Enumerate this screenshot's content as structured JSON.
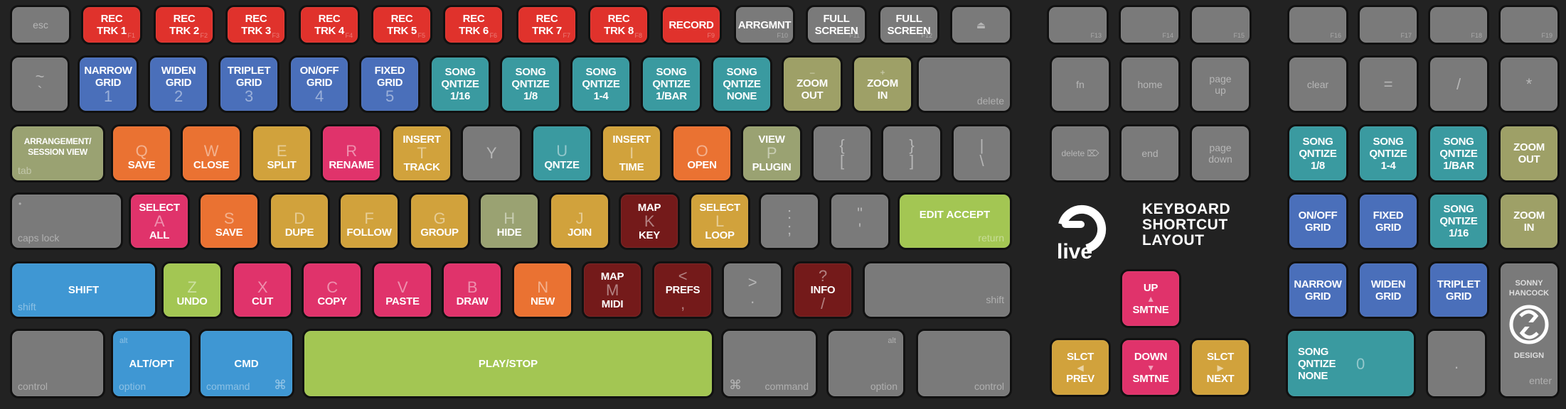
{
  "title": {
    "line1": "KEYBOARD",
    "line2": "SHORTCUT",
    "line3": "LAYOUT",
    "brand": "live"
  },
  "designer": {
    "line1": "SONNY",
    "line2": "HANCOCK",
    "line3": "DESIGN"
  },
  "colors": {
    "background": "#222222",
    "default_key": "#7a7a7a",
    "record": "#e0322c",
    "grid": "#4a6fba",
    "quantize": "#3a9aa0",
    "zoom_view": "#9ea067",
    "file_ops": "#ea7232",
    "edit": "#d1a23c",
    "clipboard": "#e0336b",
    "mapping": "#741a1a",
    "transport": "#a3c653",
    "modifier": "#3f97d3"
  },
  "row1": [
    {
      "legend": "esc"
    },
    {
      "action": [
        "REC",
        "TRK 1"
      ],
      "sub": "F1"
    },
    {
      "action": [
        "REC",
        "TRK 2"
      ],
      "sub": "F2"
    },
    {
      "action": [
        "REC",
        "TRK 3"
      ],
      "sub": "F3"
    },
    {
      "action": [
        "REC",
        "TRK 4"
      ],
      "sub": "F4"
    },
    {
      "action": [
        "REC",
        "TRK 5"
      ],
      "sub": "F5"
    },
    {
      "action": [
        "REC",
        "TRK 6"
      ],
      "sub": "F6"
    },
    {
      "action": [
        "REC",
        "TRK 7"
      ],
      "sub": "F7"
    },
    {
      "action": [
        "REC",
        "TRK 8"
      ],
      "sub": "F8"
    },
    {
      "action": [
        "RECORD"
      ],
      "sub": "F9"
    },
    {
      "action": [
        "ARRGMNT"
      ],
      "sub": "F10"
    },
    {
      "action": [
        "FULL",
        "SCREEN"
      ],
      "sub": "F11"
    },
    {
      "action": [
        "FULL",
        "SCREEN"
      ],
      "sub": "F12"
    },
    {
      "legend": "⏏"
    }
  ],
  "row2": [
    {
      "legend_top": "~",
      "legend_bottom": "`"
    },
    {
      "action_top": [
        "NARROW",
        "GRID"
      ],
      "legend": "1"
    },
    {
      "action_top": [
        "WIDEN",
        "GRID"
      ],
      "legend": "2"
    },
    {
      "action_top": [
        "TRIPLET",
        "GRID"
      ],
      "legend": "3"
    },
    {
      "action_top": [
        "ON/OFF",
        "GRID"
      ],
      "legend": "4"
    },
    {
      "action_top": [
        "FIXED",
        "GRID"
      ],
      "legend": "5"
    },
    {
      "action": [
        "SONG",
        "QNTIZE",
        "1/16"
      ]
    },
    {
      "action": [
        "SONG",
        "QNTIZE",
        "1/8"
      ]
    },
    {
      "action": [
        "SONG",
        "QNTIZE",
        "1-4"
      ]
    },
    {
      "action": [
        "SONG",
        "QNTIZE",
        "1/BAR"
      ]
    },
    {
      "action": [
        "SONG",
        "QNTIZE",
        "NONE"
      ]
    },
    {
      "symbol": "–",
      "action": [
        "ZOOM",
        "OUT"
      ]
    },
    {
      "symbol": "+",
      "action": [
        "ZOOM",
        "IN"
      ]
    },
    {
      "legend": "delete"
    }
  ],
  "row3": [
    {
      "action": [
        "ARRANGEMENT/",
        "SESSION VIEW"
      ],
      "legend": "tab"
    },
    {
      "legend": "Q",
      "action_bottom": "SAVE"
    },
    {
      "legend": "W",
      "action_bottom": "CLOSE"
    },
    {
      "legend": "E",
      "action_bottom": "SPLIT"
    },
    {
      "legend": "R",
      "action_bottom": "RENAME"
    },
    {
      "action_top": "INSERT",
      "legend": "T",
      "action_bottom": "TRACK"
    },
    {
      "legend": "Y"
    },
    {
      "legend": "U",
      "action_bottom": "QNTZE"
    },
    {
      "action_top": "INSERT",
      "legend": "I",
      "action_bottom": "TIME"
    },
    {
      "legend": "O",
      "action_bottom": "OPEN"
    },
    {
      "action_top": "VIEW",
      "legend": "P",
      "action_bottom": "PLUGIN"
    },
    {
      "legend_top": "{",
      "legend_bottom": "["
    },
    {
      "legend_top": "}",
      "legend_bottom": "]"
    },
    {
      "legend_top": "|",
      "legend_bottom": "\\"
    }
  ],
  "row4": [
    {
      "legend_top": "•",
      "legend": "caps lock"
    },
    {
      "action_top": "SELECT",
      "legend": "A",
      "action_bottom": "ALL"
    },
    {
      "legend": "S",
      "action_bottom": "SAVE"
    },
    {
      "legend": "D",
      "action_bottom": "DUPE"
    },
    {
      "legend": "F",
      "action_bottom": "FOLLOW"
    },
    {
      "legend": "G",
      "action_bottom": "GROUP"
    },
    {
      "legend": "H",
      "action_bottom": "HIDE"
    },
    {
      "legend": "J",
      "action_bottom": "JOIN"
    },
    {
      "action_top": "MAP",
      "legend": "K",
      "action_bottom": "KEY"
    },
    {
      "action_top": "SELECT",
      "legend": "L",
      "action_bottom": "LOOP"
    },
    {
      "legend_top": ":",
      "legend_bottom": ";"
    },
    {
      "legend_top": "\"",
      "legend_bottom": "'"
    },
    {
      "action": "EDIT ACCEPT",
      "legend": "return"
    }
  ],
  "row5": [
    {
      "action": "SHIFT",
      "legend": "shift"
    },
    {
      "legend": "Z",
      "action_bottom": "UNDO"
    },
    {
      "legend": "X",
      "action_bottom": "CUT"
    },
    {
      "legend": "C",
      "action_bottom": "COPY"
    },
    {
      "legend": "V",
      "action_bottom": "PASTE"
    },
    {
      "legend": "B",
      "action_bottom": "DRAW"
    },
    {
      "legend": "N",
      "action_bottom": "NEW"
    },
    {
      "action_top": "MAP",
      "legend": "M",
      "action_bottom": "MIDI"
    },
    {
      "legend_top": "<",
      "action": "PREFS",
      "legend_bottom": ","
    },
    {
      "legend_top": ">",
      "legend_bottom": "."
    },
    {
      "legend_top": "?",
      "action": "INFO",
      "legend_bottom": "/"
    },
    {
      "legend": "shift"
    }
  ],
  "row6": [
    {
      "legend": "control"
    },
    {
      "legend_top": "alt",
      "action": "ALT/OPT",
      "legend": "option"
    },
    {
      "action": "CMD",
      "legend": "command",
      "symbol": "⌘"
    },
    {
      "action": "PLAY/STOP"
    },
    {
      "symbol": "⌘",
      "legend": "command"
    },
    {
      "legend_top": "alt",
      "legend": "option"
    },
    {
      "legend": "control"
    }
  ],
  "nav": {
    "f13": "F13",
    "f14": "F14",
    "f15": "F15",
    "fn": "fn",
    "home": "home",
    "page_up": [
      "page",
      "up"
    ],
    "delete_fwd": "delete ⌦",
    "end": "end",
    "page_down": [
      "page",
      "down"
    ],
    "up": {
      "top": "UP",
      "arrow": "▲",
      "bottom": "SMTNE"
    },
    "left": {
      "top": "SLCT",
      "arrow": "◀",
      "bottom": "PREV"
    },
    "down": {
      "top": "DOWN",
      "arrow": "▼",
      "bottom": "SMTNE"
    },
    "right": {
      "top": "SLCT",
      "arrow": "▶",
      "bottom": "NEXT"
    }
  },
  "numpad": {
    "f16": "F16",
    "f17": "F17",
    "f18": "F18",
    "f19": "F19",
    "clear": "clear",
    "equals": "=",
    "divide": "/",
    "multiply": "*",
    "k7": [
      "SONG",
      "QNTIZE",
      "1/8"
    ],
    "k8": [
      "SONG",
      "QNTIZE",
      "1-4"
    ],
    "k9": [
      "SONG",
      "QNTIZE",
      "1/BAR"
    ],
    "minus": [
      "ZOOM",
      "OUT"
    ],
    "k4": [
      "ON/OFF",
      "GRID"
    ],
    "k5": [
      "FIXED",
      "GRID"
    ],
    "k6": [
      "SONG",
      "QNTIZE",
      "1/16"
    ],
    "plus": [
      "ZOOM",
      "IN"
    ],
    "k1": [
      "NARROW",
      "GRID"
    ],
    "k2": [
      "WIDEN",
      "GRID"
    ],
    "k3": [
      "TRIPLET",
      "GRID"
    ],
    "k0": {
      "action": [
        "SONG",
        "QNTIZE",
        "NONE"
      ],
      "legend": "0"
    },
    "decimal": ".",
    "enter": "enter"
  }
}
